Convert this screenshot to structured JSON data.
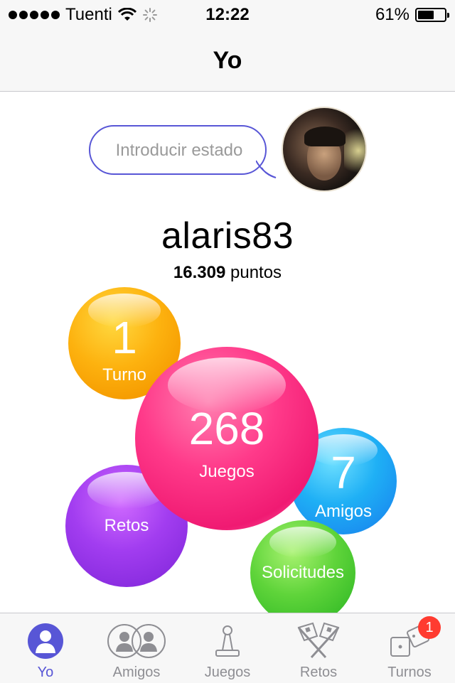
{
  "status_bar": {
    "carrier": "Tuenti",
    "time": "12:22",
    "battery_percent": "61%",
    "battery_level": 0.61
  },
  "nav": {
    "title": "Yo"
  },
  "profile": {
    "status_placeholder": "Introducir estado",
    "username": "alaris83",
    "points_value": "16.309",
    "points_label": "puntos"
  },
  "bubbles": {
    "turno": {
      "count": "1",
      "label": "Turno",
      "color": "#fdb20f"
    },
    "juegos": {
      "count": "268",
      "label": "Juegos",
      "color": "#ff3a8a"
    },
    "amigos": {
      "count": "7",
      "label": "Amigos",
      "color": "#1fb0f5"
    },
    "retos": {
      "label": "Retos",
      "color": "#a23df0"
    },
    "solicitudes": {
      "label": "Solicitudes",
      "color": "#5fd43a"
    }
  },
  "tabs": [
    {
      "label": "Yo",
      "icon": "person-icon",
      "active": true
    },
    {
      "label": "Amigos",
      "icon": "two-people-icon",
      "active": false
    },
    {
      "label": "Juegos",
      "icon": "game-piece-icon",
      "active": false
    },
    {
      "label": "Retos",
      "icon": "crossed-flags-icon",
      "active": false
    },
    {
      "label": "Turnos",
      "icon": "dice-icon",
      "active": false,
      "badge": "1"
    }
  ],
  "colors": {
    "accent": "#5856d6",
    "badge": "#ff3b30"
  }
}
